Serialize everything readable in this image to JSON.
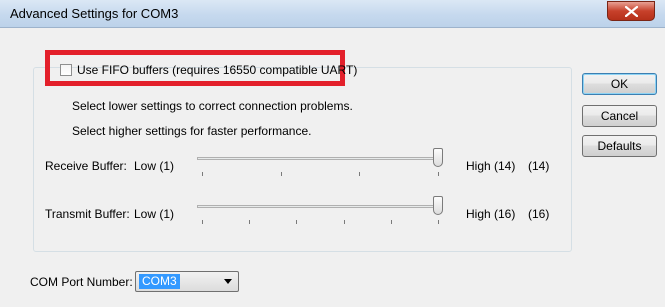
{
  "window": {
    "title": "Advanced Settings for COM3"
  },
  "fifo": {
    "label": "Use FIFO buffers (requires 16550 compatible UART)",
    "checked": false
  },
  "hints": {
    "lower": "Select lower settings to correct connection problems.",
    "higher": "Select higher settings for faster performance."
  },
  "receive": {
    "label": "Receive Buffer:",
    "low_label": "Low (1)",
    "high_label": "High (14)",
    "value_display": "(14)",
    "value": 14,
    "min": 1,
    "max": 14
  },
  "transmit": {
    "label": "Transmit Buffer:",
    "low_label": "Low (1)",
    "high_label": "High (16)",
    "value_display": "(16)",
    "value": 16,
    "min": 1,
    "max": 16
  },
  "buttons": {
    "ok": "OK",
    "cancel": "Cancel",
    "defaults": "Defaults"
  },
  "com_port": {
    "label": "COM Port Number:",
    "selected": "COM3"
  },
  "colors": {
    "highlight": "#e3202b",
    "selection": "#3399ff",
    "close": "#c7412b"
  },
  "icons": {
    "close": "close-icon",
    "dropdown": "chevron-down-icon"
  }
}
